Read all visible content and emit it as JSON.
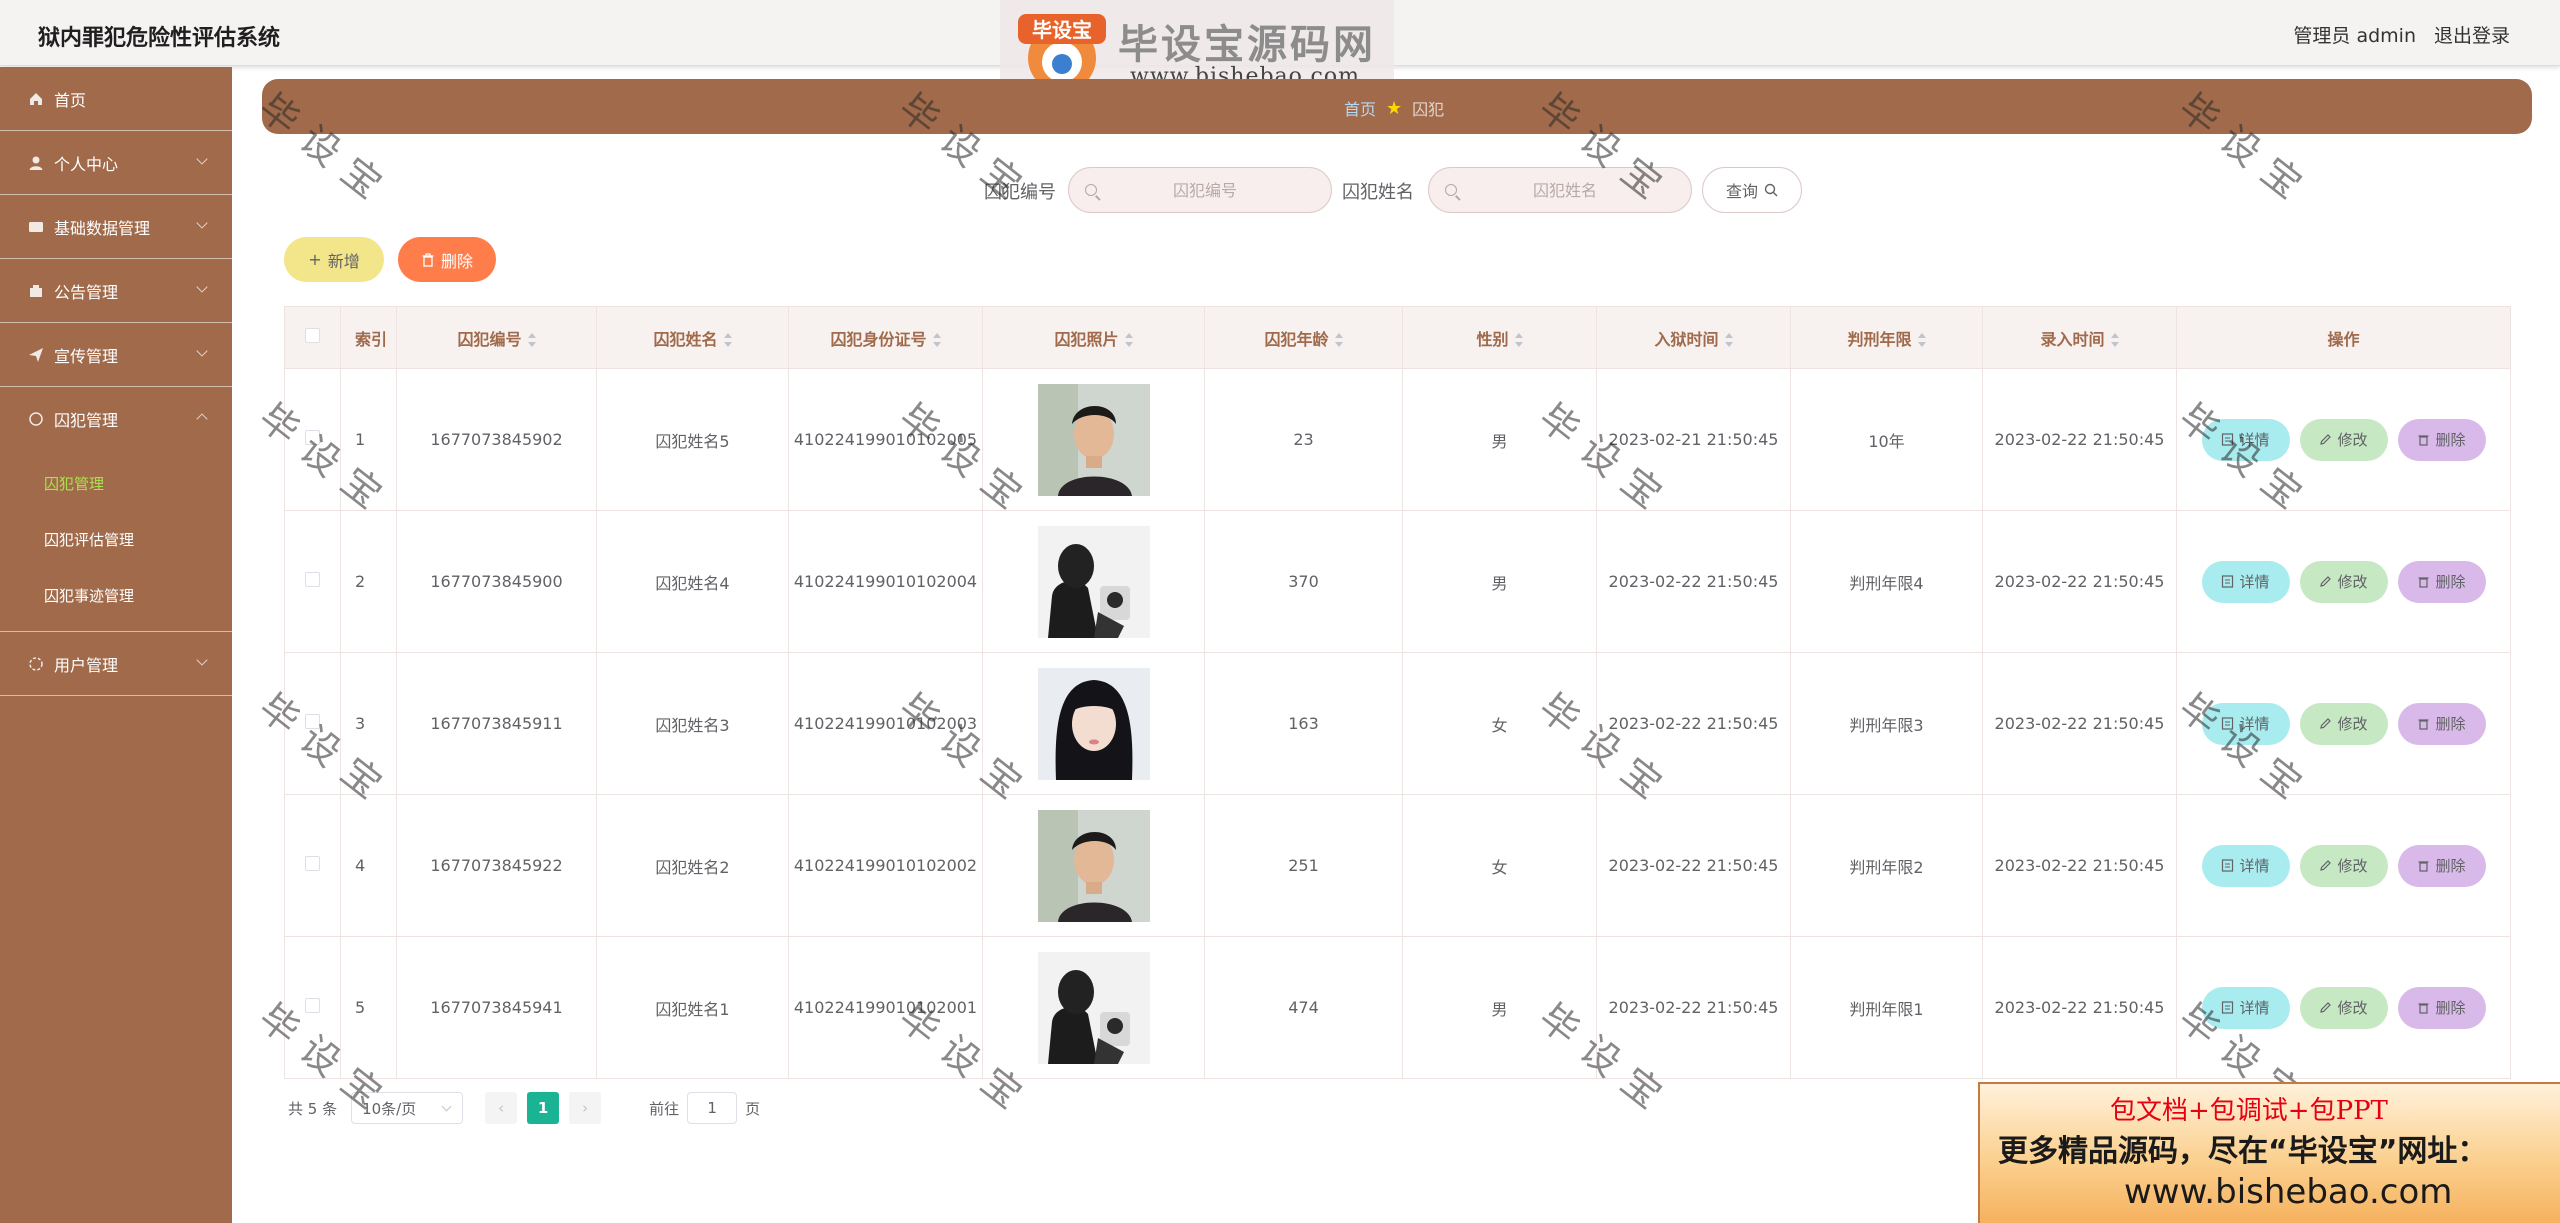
{
  "app": {
    "title": "狱内罪犯危险性评估系统",
    "admin_label": "管理员 admin",
    "logout_label": "退出登录"
  },
  "watermark": {
    "logo_badge": "毕设宝",
    "logo_text": "毕设宝源码网",
    "logo_url": "www.bishebao.com",
    "repeat_text": "毕设宝"
  },
  "sidebar": {
    "items": [
      {
        "label": "首页",
        "icon": "home-icon"
      },
      {
        "label": "个人中心",
        "icon": "user-icon"
      },
      {
        "label": "基础数据管理",
        "icon": "data-icon"
      },
      {
        "label": "公告管理",
        "icon": "notice-icon"
      },
      {
        "label": "宣传管理",
        "icon": "send-icon"
      },
      {
        "label": "囚犯管理",
        "icon": "prisoner-icon"
      },
      {
        "label": "用户管理",
        "icon": "users-icon"
      }
    ],
    "submenu": [
      {
        "label": "囚犯管理",
        "active": true
      },
      {
        "label": "囚犯评估管理",
        "active": false
      },
      {
        "label": "囚犯事迹管理",
        "active": false
      }
    ]
  },
  "breadcrumb": {
    "home": "首页",
    "current": "囚犯"
  },
  "search": {
    "field1_label": "囚犯编号",
    "field1_placeholder": "囚犯编号",
    "field2_label": "囚犯姓名",
    "field2_placeholder": "囚犯姓名",
    "query_label": "查询"
  },
  "actions": {
    "add_label": "新增",
    "delete_label": "删除"
  },
  "table": {
    "headers": [
      "索引",
      "囚犯编号",
      "囚犯姓名",
      "囚犯身份证号",
      "囚犯照片",
      "囚犯年龄",
      "性别",
      "入狱时间",
      "判刑年限",
      "录入时间",
      "操作"
    ],
    "rows": [
      {
        "index": "1",
        "code": "1677073845902",
        "name": "囚犯姓名5",
        "id_card": "410224199010102005",
        "photo": "man-sweater",
        "age": "23",
        "gender": "男",
        "jail_time": "2023-02-21 21:50:45",
        "sentence": "10年",
        "entry_time": "2023-02-22 21:50:45"
      },
      {
        "index": "2",
        "code": "1677073845900",
        "name": "囚犯姓名4",
        "id_card": "410224199010102004",
        "photo": "man-silhouette",
        "age": "370",
        "gender": "男",
        "jail_time": "2023-02-22 21:50:45",
        "sentence": "判刑年限4",
        "entry_time": "2023-02-22 21:50:45"
      },
      {
        "index": "3",
        "code": "1677073845911",
        "name": "囚犯姓名3",
        "id_card": "410224199010102003",
        "photo": "woman-portrait",
        "age": "163",
        "gender": "女",
        "jail_time": "2023-02-22 21:50:45",
        "sentence": "判刑年限3",
        "entry_time": "2023-02-22 21:50:45"
      },
      {
        "index": "4",
        "code": "1677073845922",
        "name": "囚犯姓名2",
        "id_card": "410224199010102002",
        "photo": "man-sweater",
        "age": "251",
        "gender": "女",
        "jail_time": "2023-02-22 21:50:45",
        "sentence": "判刑年限2",
        "entry_time": "2023-02-22 21:50:45"
      },
      {
        "index": "5",
        "code": "1677073845941",
        "name": "囚犯姓名1",
        "id_card": "410224199010102001",
        "photo": "man-silhouette",
        "age": "474",
        "gender": "男",
        "jail_time": "2023-02-22 21:50:45",
        "sentence": "判刑年限1",
        "entry_time": "2023-02-22 21:50:45"
      }
    ],
    "row_actions": {
      "detail": "详情",
      "edit": "修改",
      "remove": "删除"
    }
  },
  "pagination": {
    "total": "共 5 条",
    "page_size": "10条/页",
    "current_page": "1",
    "goto_prefix": "前往",
    "goto_value": "1",
    "goto_suffix": "页"
  },
  "ad": {
    "line1": "包文档+包调试+包PPT",
    "line2": "更多精品源码，尽在“毕设宝”网址：",
    "line3": "www.bishebao.com"
  },
  "colors": {
    "sidebar": "#a06a4b",
    "active_sub": "#a9e34b",
    "page_active": "#1ab394",
    "add_button": "#f3e58a",
    "delete_button": "#ff7d4a",
    "detail_button": "#a9ecef",
    "edit_button": "#c6e8c2",
    "remove_button": "#d9b9e9"
  }
}
